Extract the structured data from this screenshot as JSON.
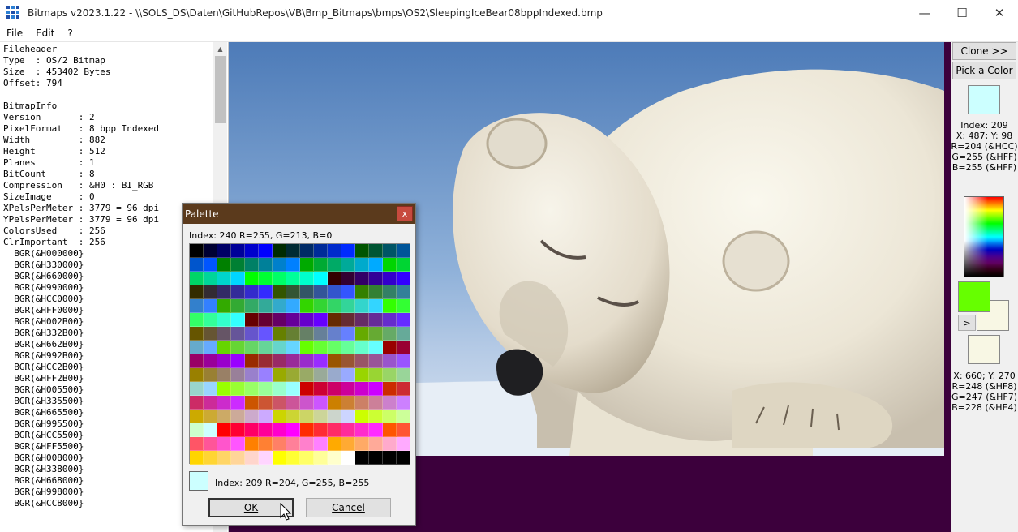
{
  "window": {
    "title": "Bitmaps v2023.1.22 - \\\\SOLS_DS\\Daten\\GitHubRepos\\VB\\Bmp_Bitmaps\\bmps\\OS2\\SleepingIceBear08bppIndexed.bmp",
    "minimize": "—",
    "maximize": "☐",
    "close": "✕"
  },
  "menu": [
    "File",
    "Edit",
    "?"
  ],
  "header_text": "Fileheader\nType  : OS/2 Bitmap\nSize  : 453402 Bytes\nOffset: 794\n\nBitmapInfo\nVersion       : 2\nPixelFormat   : 8 bpp Indexed\nWidth         : 882\nHeight        : 512\nPlanes        : 1\nBitCount      : 8\nCompression   : &H0 : BI_RGB\nSizeImage     : 0\nXPelsPerMeter : 3779 = 96 dpi\nYPelsPerMeter : 3779 = 96 dpi\nColorsUsed    : 256\nClrImportant  : 256\n  BGR(&H000000}\n  BGR(&H330000}\n  BGR(&H660000}\n  BGR(&H990000}\n  BGR(&HCC0000}\n  BGR(&HFF0000}\n  BGR(&H002B00}\n  BGR(&H332B00}\n  BGR(&H662B00}\n  BGR(&H992B00}\n  BGR(&HCC2B00}\n  BGR(&HFF2B00}\n  BGR(&H005500}\n  BGR(&H335500}\n  BGR(&H665500}\n  BGR(&H995500}\n  BGR(&HCC5500}\n  BGR(&HFF5500}\n  BGR(&H008000}\n  BGR(&H338000}\n  BGR(&H668000}\n  BGR(&H998000}\n  BGR(&HCC8000}",
  "right_panel": {
    "clone_label": "Clone >>",
    "pick_label": "Pick a Color",
    "picked_color": "#ccffff",
    "picked_info": [
      "Index: 209",
      "X: 487; Y: 98",
      "R=204 (&HCC)",
      "G=255 (&HFF)",
      "B=255 (&HFF)"
    ],
    "fore_color": "#66ff00",
    "back_color": "#f8f7e4",
    "swap_label": ">",
    "hover_color": "#f8f7e4",
    "hover_info": [
      "X: 660; Y: 270",
      "R=248 (&HF8)",
      "G=247 (&HF7)",
      "B=228 (&HE4)"
    ]
  },
  "palette_dialog": {
    "title": "Palette",
    "close": "x",
    "header": "Index: 240 R=255, G=213, B=0",
    "selected_color": "#ccffff",
    "selected_text": "Index: 209 R=204, G=255, B=255",
    "ok_label": "OK",
    "cancel_label": "Cancel",
    "colors": [
      "#000000",
      "#000033",
      "#000066",
      "#000099",
      "#0000cc",
      "#0000ff",
      "#002b00",
      "#002b33",
      "#002b66",
      "#002b99",
      "#002bcc",
      "#002bff",
      "#005500",
      "#005533",
      "#005566",
      "#005599",
      "#0055cc",
      "#0055ff",
      "#008000",
      "#008033",
      "#008066",
      "#008099",
      "#0080cc",
      "#0080ff",
      "#00aa00",
      "#00aa33",
      "#00aa66",
      "#00aa99",
      "#00aacc",
      "#00aaff",
      "#00d500",
      "#00d533",
      "#00d566",
      "#00d599",
      "#00d5cc",
      "#00d5ff",
      "#00ff00",
      "#00ff33",
      "#00ff66",
      "#00ff99",
      "#00ffcc",
      "#00ffff",
      "#330000",
      "#330033",
      "#330066",
      "#330099",
      "#3300cc",
      "#3300ff",
      "#332b00",
      "#332b33",
      "#332b66",
      "#332b99",
      "#332bcc",
      "#332bff",
      "#335500",
      "#335533",
      "#335566",
      "#335599",
      "#3355cc",
      "#3355ff",
      "#338000",
      "#338033",
      "#338066",
      "#338099",
      "#3380cc",
      "#3380ff",
      "#33aa00",
      "#33aa33",
      "#33aa66",
      "#33aa99",
      "#33aacc",
      "#33aaff",
      "#33d500",
      "#33d533",
      "#33d566",
      "#33d599",
      "#33d5cc",
      "#33d5ff",
      "#33ff00",
      "#33ff33",
      "#33ff66",
      "#33ff99",
      "#33ffcc",
      "#33ffff",
      "#660000",
      "#660033",
      "#660066",
      "#660099",
      "#6600cc",
      "#6600ff",
      "#662b00",
      "#662b33",
      "#662b66",
      "#662b99",
      "#662bcc",
      "#662bff",
      "#665500",
      "#665533",
      "#665566",
      "#665599",
      "#6655cc",
      "#6655ff",
      "#668000",
      "#668033",
      "#668066",
      "#668099",
      "#6680cc",
      "#6680ff",
      "#66aa00",
      "#66aa33",
      "#66aa66",
      "#66aa99",
      "#66aacc",
      "#66aaff",
      "#66d500",
      "#66d533",
      "#66d566",
      "#66d599",
      "#66d5cc",
      "#66d5ff",
      "#66ff00",
      "#66ff33",
      "#66ff66",
      "#66ff99",
      "#66ffcc",
      "#66ffff",
      "#990000",
      "#990033",
      "#990066",
      "#990099",
      "#9900cc",
      "#9900ff",
      "#992b00",
      "#992b33",
      "#992b66",
      "#992b99",
      "#992bcc",
      "#992bff",
      "#995500",
      "#995533",
      "#995566",
      "#995599",
      "#9955cc",
      "#9955ff",
      "#998000",
      "#998033",
      "#998066",
      "#998099",
      "#9980cc",
      "#9980ff",
      "#99aa00",
      "#99aa33",
      "#99aa66",
      "#99aa99",
      "#99aacc",
      "#99aaff",
      "#99d500",
      "#99d533",
      "#99d566",
      "#99d599",
      "#99d5cc",
      "#99d5ff",
      "#99ff00",
      "#99ff33",
      "#99ff66",
      "#99ff99",
      "#99ffcc",
      "#99ffff",
      "#cc0000",
      "#cc0033",
      "#cc0066",
      "#cc0099",
      "#cc00cc",
      "#cc00ff",
      "#cc2b00",
      "#cc2b33",
      "#cc2b66",
      "#cc2b99",
      "#cc2bcc",
      "#cc2bff",
      "#cc5500",
      "#cc5533",
      "#cc5566",
      "#cc5599",
      "#cc55cc",
      "#cc55ff",
      "#cc8000",
      "#cc8033",
      "#cc8066",
      "#cc8099",
      "#cc80cc",
      "#cc80ff",
      "#ccaa00",
      "#ccaa33",
      "#ccaa66",
      "#ccaa99",
      "#ccaacc",
      "#ccaaff",
      "#ccd500",
      "#ccd533",
      "#ccd566",
      "#ccd599",
      "#ccd5cc",
      "#ccd5ff",
      "#ccff00",
      "#ccff33",
      "#ccff66",
      "#ccff99",
      "#ccffcc",
      "#ccffff",
      "#ff0000",
      "#ff0033",
      "#ff0066",
      "#ff0099",
      "#ff00cc",
      "#ff00ff",
      "#ff2b00",
      "#ff2b33",
      "#ff2b66",
      "#ff2b99",
      "#ff2bcc",
      "#ff2bff",
      "#ff5500",
      "#ff5533",
      "#ff5566",
      "#ff5599",
      "#ff55cc",
      "#ff55ff",
      "#ff8000",
      "#ff8033",
      "#ff8066",
      "#ff8099",
      "#ff80cc",
      "#ff80ff",
      "#ffaa00",
      "#ffaa33",
      "#ffaa66",
      "#ffaa99",
      "#ffaacc",
      "#ffaaff",
      "#ffd500",
      "#ffd533",
      "#ffd566",
      "#ffd599",
      "#ffd5cc",
      "#ffd5ff",
      "#ffff00",
      "#ffff33",
      "#ffff66",
      "#ffff99",
      "#ffffcc",
      "#ffffff",
      "#000000",
      "#000000",
      "#000000",
      "#000000"
    ]
  }
}
